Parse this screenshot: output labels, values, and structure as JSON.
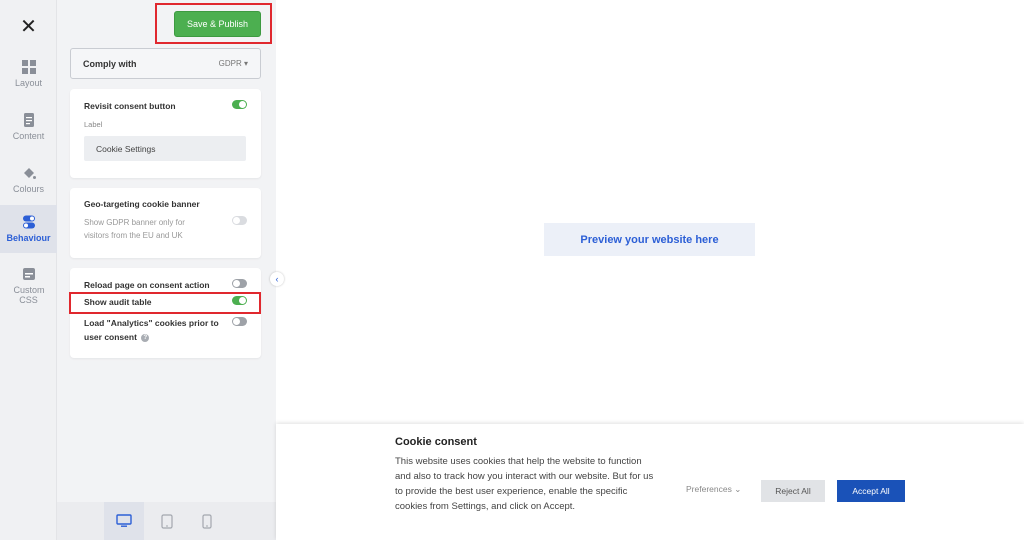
{
  "rail": {
    "close_glyph": "✕",
    "items": [
      {
        "label": "Layout",
        "icon": "layout-grid-icon"
      },
      {
        "label": "Content",
        "icon": "document-icon"
      },
      {
        "label": "Colours",
        "icon": "paint-bucket-icon"
      },
      {
        "label": "Behaviour",
        "icon": "toggle-settings-icon"
      },
      {
        "label": "Custom CSS",
        "icon": "css-file-icon"
      }
    ]
  },
  "toolbar": {
    "publish_label": "Save & Publish"
  },
  "comply": {
    "label": "Comply with",
    "value": "GDPR",
    "caret": "▾"
  },
  "revisit": {
    "title": "Revisit consent button",
    "enabled": true,
    "field_label": "Label",
    "field_value": "Cookie Settings"
  },
  "geo": {
    "title": "Geo-targeting cookie banner",
    "description": "Show GDPR banner only for visitors from the EU and UK",
    "enabled": false
  },
  "options": [
    {
      "label": "Reload page on consent action",
      "enabled": false
    },
    {
      "label": "Show audit table",
      "enabled": true
    },
    {
      "label": "Load \"Analytics\" cookies prior to user consent",
      "enabled": false,
      "info": "?"
    }
  ],
  "collapse_glyph": "‹",
  "preview": {
    "label": "Preview your website here"
  },
  "banner": {
    "title": "Cookie consent",
    "text": "This website uses cookies that help the website to function and also to track how you interact with our website. But for us to provide the best user experience, enable the specific cookies from Settings, and click on Accept.",
    "preferences_label": "Preferences",
    "preferences_caret": "⌄",
    "reject_label": "Reject All",
    "accept_label": "Accept All"
  },
  "devices": [
    "desktop-icon",
    "tablet-icon",
    "mobile-icon"
  ],
  "colors": {
    "accent": "#2c5fd6",
    "publish": "#4caf50",
    "accept": "#1a52b8",
    "highlight": "#e0282e"
  }
}
